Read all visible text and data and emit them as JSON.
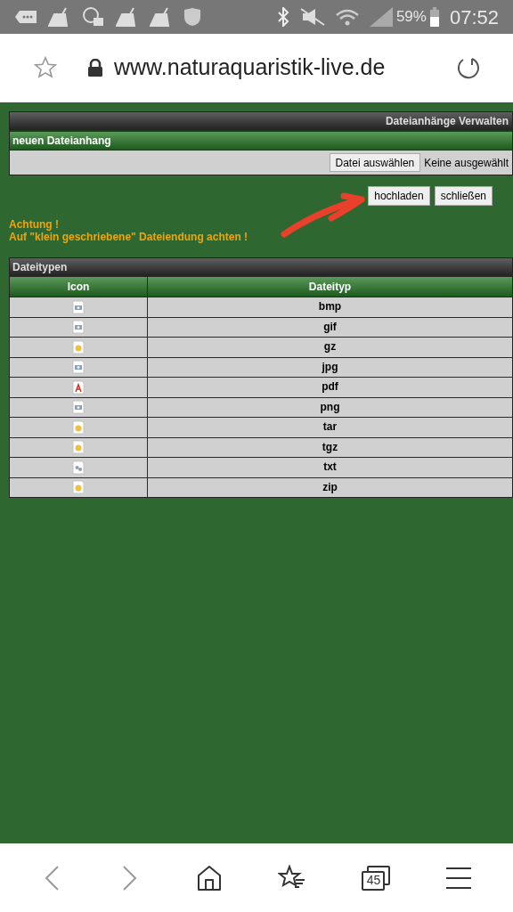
{
  "status_bar": {
    "battery": "59%",
    "time": "07:52"
  },
  "address_bar": {
    "url": "www.naturaquaristik-live.de"
  },
  "upload_panel": {
    "title": "Dateianhänge Verwalten",
    "subtitle": "neuen Dateianhang",
    "file_button": "Datei auswählen",
    "file_status": "Keine ausgewählt"
  },
  "actions": [
    "hochladen",
    "schließen"
  ],
  "warning": [
    "Achtung !",
    "Auf \"klein geschriebene\" Dateiendung achten !"
  ],
  "filetypes": {
    "title": "Dateitypen",
    "columns": [
      "Icon",
      "Dateityp"
    ],
    "rows": [
      {
        "kind": "image",
        "type": "bmp"
      },
      {
        "kind": "image",
        "type": "gif"
      },
      {
        "kind": "archive",
        "type": "gz"
      },
      {
        "kind": "image",
        "type": "jpg"
      },
      {
        "kind": "pdf",
        "type": "pdf"
      },
      {
        "kind": "image",
        "type": "png"
      },
      {
        "kind": "archive",
        "type": "tar"
      },
      {
        "kind": "archive",
        "type": "tgz"
      },
      {
        "kind": "text",
        "type": "txt"
      },
      {
        "kind": "archive",
        "type": "zip"
      }
    ]
  },
  "bottom_nav": {
    "tab_count": "45"
  }
}
